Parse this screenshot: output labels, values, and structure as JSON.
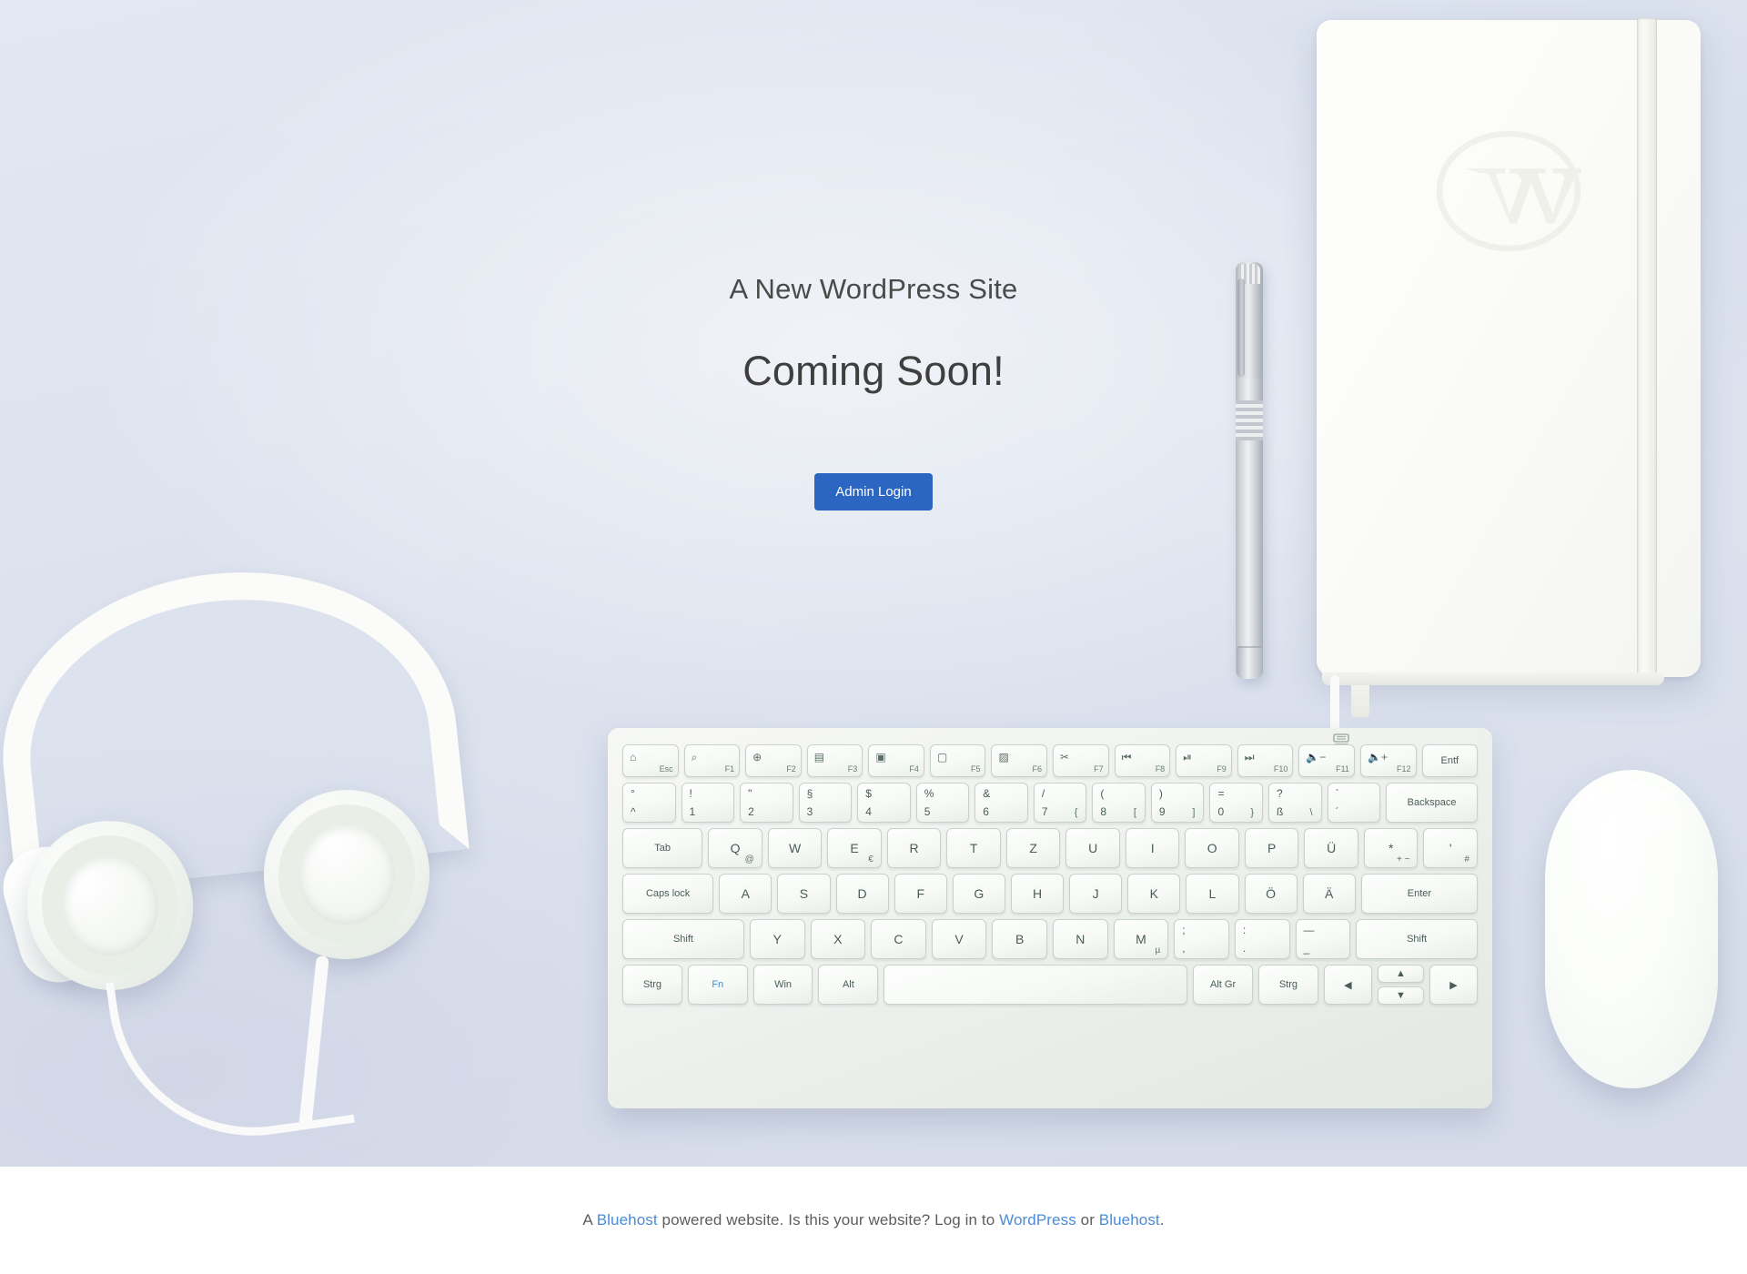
{
  "hero": {
    "site_title": "A New WordPress Site",
    "coming_soon": "Coming Soon!",
    "admin_login_label": "Admin Login",
    "accent_color": "#2b66c2",
    "background_color": "#dfe4ef",
    "heading_color": "#444444"
  },
  "footer": {
    "prefix": "A ",
    "link_bluehost_1": "Bluehost",
    "middle": " powered website. Is this your website? Log in to ",
    "link_wordpress": "WordPress",
    "conjunction": " or ",
    "link_bluehost_2": "Bluehost",
    "suffix": ".",
    "link_color": "#4a8bd8",
    "text_color": "#5d5d5d"
  },
  "photo_objects": {
    "notebook": {
      "name": "wordpress-notebook",
      "logo": "wordpress-w-logo"
    },
    "pen": {
      "name": "silver-pen"
    },
    "headphones": {
      "name": "white-headphones"
    },
    "mouse": {
      "name": "white-mouse"
    },
    "keyboard": {
      "name": "german-qwertz-keyboard",
      "battery_icon": "keyboard-battery-icon"
    }
  },
  "keyboard": {
    "layout": "QWERTZ (German)",
    "rows": {
      "function": [
        {
          "icon": "⌂",
          "label": "Esc",
          "icon_name": "home-icon"
        },
        {
          "icon": "⌕",
          "label": "F1",
          "icon_name": "search-icon"
        },
        {
          "icon": "⊕",
          "label": "F2",
          "icon_name": "globe-icon"
        },
        {
          "icon": "▤",
          "label": "F3",
          "icon_name": "window-icon"
        },
        {
          "icon": "▣",
          "label": "F4",
          "icon_name": "app-icon"
        },
        {
          "icon": "▢",
          "label": "F5",
          "icon_name": "document-icon"
        },
        {
          "icon": "▨",
          "label": "F6",
          "icon_name": "image-icon"
        },
        {
          "icon": "✂",
          "label": "F7",
          "icon_name": "scissors-icon"
        },
        {
          "icon": "⏮",
          "label": "F8",
          "icon_name": "previous-track-icon"
        },
        {
          "icon": "⏯",
          "label": "F9",
          "icon_name": "play-pause-icon"
        },
        {
          "icon": "⏭",
          "label": "F10",
          "icon_name": "next-track-icon"
        },
        {
          "icon": "🔈−",
          "label": "F11",
          "icon_name": "volume-down-icon"
        },
        {
          "icon": "🔈+",
          "label": "F12",
          "icon_name": "volume-up-icon"
        },
        {
          "icon": "",
          "label": "Entf",
          "icon_name": "delete-key"
        }
      ],
      "numbers": [
        {
          "top": "°",
          "bottom": "^"
        },
        {
          "top": "!",
          "bottom": "1"
        },
        {
          "top": "\"",
          "bottom": "2"
        },
        {
          "top": "§",
          "bottom": "3"
        },
        {
          "top": "$",
          "bottom": "4"
        },
        {
          "top": "%",
          "bottom": "5"
        },
        {
          "top": "&",
          "bottom": "6"
        },
        {
          "top": "/",
          "bottom": "7",
          "alt": "{"
        },
        {
          "top": "(",
          "bottom": "8",
          "alt": "["
        },
        {
          "top": ")",
          "bottom": "9",
          "alt": "]"
        },
        {
          "top": "=",
          "bottom": "0",
          "alt": "}"
        },
        {
          "top": "?",
          "bottom": "ß",
          "alt": "\\"
        },
        {
          "top": "`",
          "bottom": "´"
        }
      ],
      "backspace": "Backspace",
      "tab": "Tab",
      "qwertz": [
        {
          "main": "Q",
          "sub": "@"
        },
        {
          "main": "W"
        },
        {
          "main": "E",
          "sub": "€"
        },
        {
          "main": "R"
        },
        {
          "main": "T"
        },
        {
          "main": "Z"
        },
        {
          "main": "U"
        },
        {
          "main": "I"
        },
        {
          "main": "O"
        },
        {
          "main": "P"
        },
        {
          "main": "Ü"
        },
        {
          "main": "*",
          "sub": "+ ~"
        },
        {
          "main": "'",
          "sub": "#"
        }
      ],
      "caps_lock": "Caps lock",
      "home": [
        {
          "main": "A"
        },
        {
          "main": "S"
        },
        {
          "main": "D"
        },
        {
          "main": "F"
        },
        {
          "main": "G"
        },
        {
          "main": "H"
        },
        {
          "main": "J"
        },
        {
          "main": "K"
        },
        {
          "main": "L"
        },
        {
          "main": "Ö"
        },
        {
          "main": "Ä"
        }
      ],
      "enter": "Enter",
      "shift_left": "Shift",
      "bottom_alpha": [
        {
          "main": "Y"
        },
        {
          "main": "X"
        },
        {
          "main": "C"
        },
        {
          "main": "V"
        },
        {
          "main": "B"
        },
        {
          "main": "N"
        },
        {
          "main": "M",
          "sub": "µ"
        },
        {
          "main": ";",
          "sub": ","
        },
        {
          "main": ":",
          "sub": "."
        },
        {
          "main": "—",
          "sub": "_"
        }
      ],
      "shift_right": "Shift",
      "modifiers": [
        {
          "label": "Strg"
        },
        {
          "label": "Fn",
          "highlight": true
        },
        {
          "label": "Win"
        },
        {
          "label": "Alt"
        },
        {
          "label": ""
        },
        {
          "label": "Alt Gr"
        },
        {
          "label": "Strg"
        }
      ],
      "arrows": {
        "left": "◀",
        "up": "▲",
        "down": "▼",
        "right": "▶"
      }
    }
  }
}
